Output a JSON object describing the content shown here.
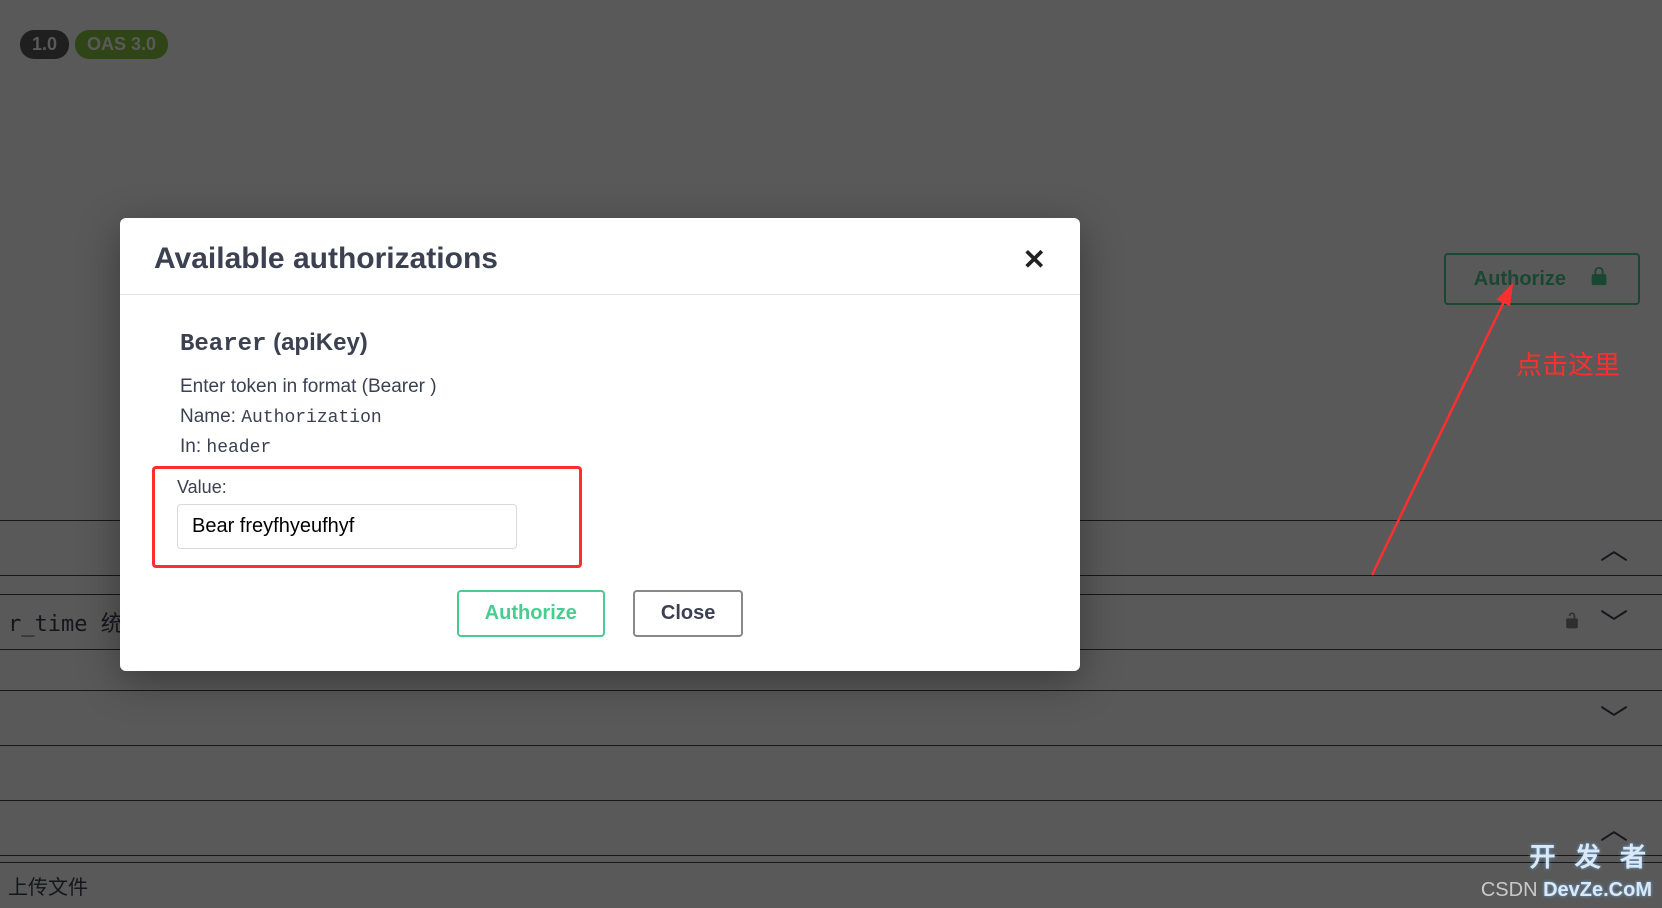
{
  "badges": {
    "version": "1.0",
    "oas": "OAS 3.0"
  },
  "authorize_button": {
    "label": "Authorize"
  },
  "annotation": {
    "text": "点击这里"
  },
  "modal": {
    "title": "Available authorizations",
    "scheme_code": "Bearer",
    "scheme_suffix": " (apiKey)",
    "desc": "Enter token in format (Bearer )",
    "name_label": "Name: ",
    "name_value": "Authorization",
    "in_label": "In: ",
    "in_value": "header",
    "value_label": "Value:",
    "value_input": "Bear freyfhyeufhyf",
    "authorize_label": "Authorize",
    "close_label": "Close"
  },
  "section_left": "r_time 统i",
  "upload_text": "上传文件",
  "watermark": {
    "line1": "开 发 者",
    "csdn": "CSDN ",
    "devze": "DevZe.CoM"
  }
}
